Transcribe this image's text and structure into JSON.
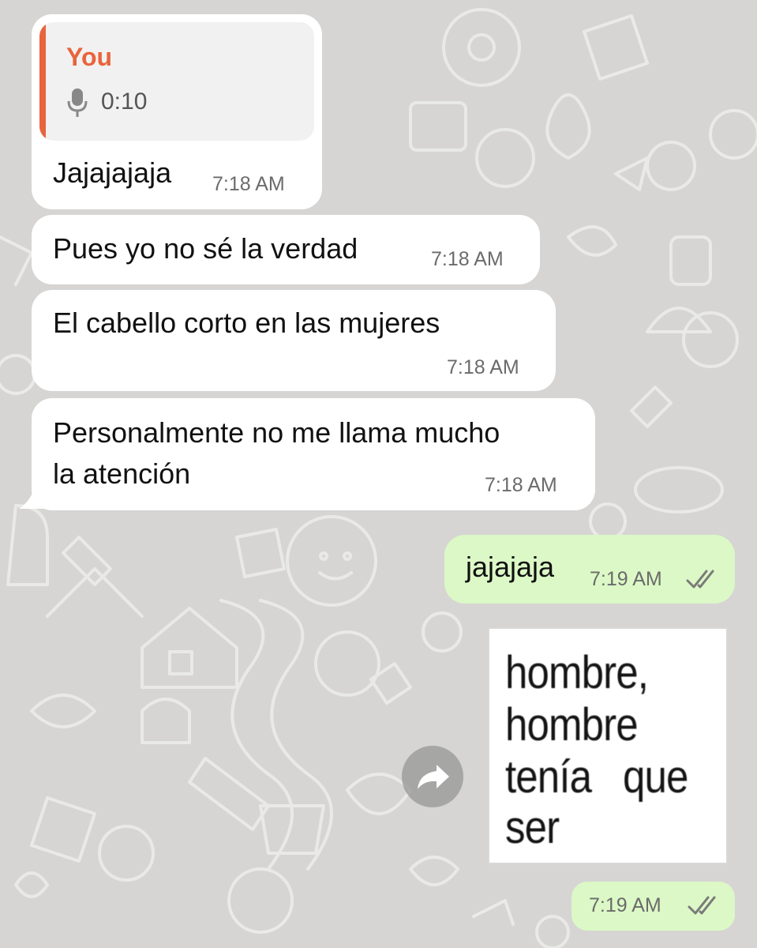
{
  "colors": {
    "background": "#d6d5d3",
    "incoming_bubble": "#ffffff",
    "outgoing_bubble": "#dcf8c6",
    "reply_accent": "#e8643c",
    "timestamp": "#6b6b6b"
  },
  "messages": [
    {
      "direction": "incoming",
      "reply": {
        "author": "You",
        "icon": "mic-icon",
        "duration": "0:10"
      },
      "text": "Jajajajaja",
      "time": "7:18 AM"
    },
    {
      "direction": "incoming",
      "text": "Pues yo no sé la verdad",
      "time": "7:18 AM"
    },
    {
      "direction": "incoming",
      "text": "El cabello corto en las mujeres",
      "time": "7:18 AM"
    },
    {
      "direction": "incoming",
      "lines": [
        "Personalmente no me llama mucho",
        "la atención"
      ],
      "time": "7:18 AM"
    },
    {
      "direction": "outgoing",
      "text": "jajajaja",
      "time": "7:19 AM",
      "status_icon": "double-check-icon"
    },
    {
      "direction": "outgoing",
      "type": "sticker",
      "sticker_lines": [
        "hombre,",
        "hombre",
        "tenía   que",
        "ser"
      ],
      "forward_icon": "forward-icon",
      "time": "7:19 AM",
      "status_icon": "double-check-icon"
    }
  ]
}
